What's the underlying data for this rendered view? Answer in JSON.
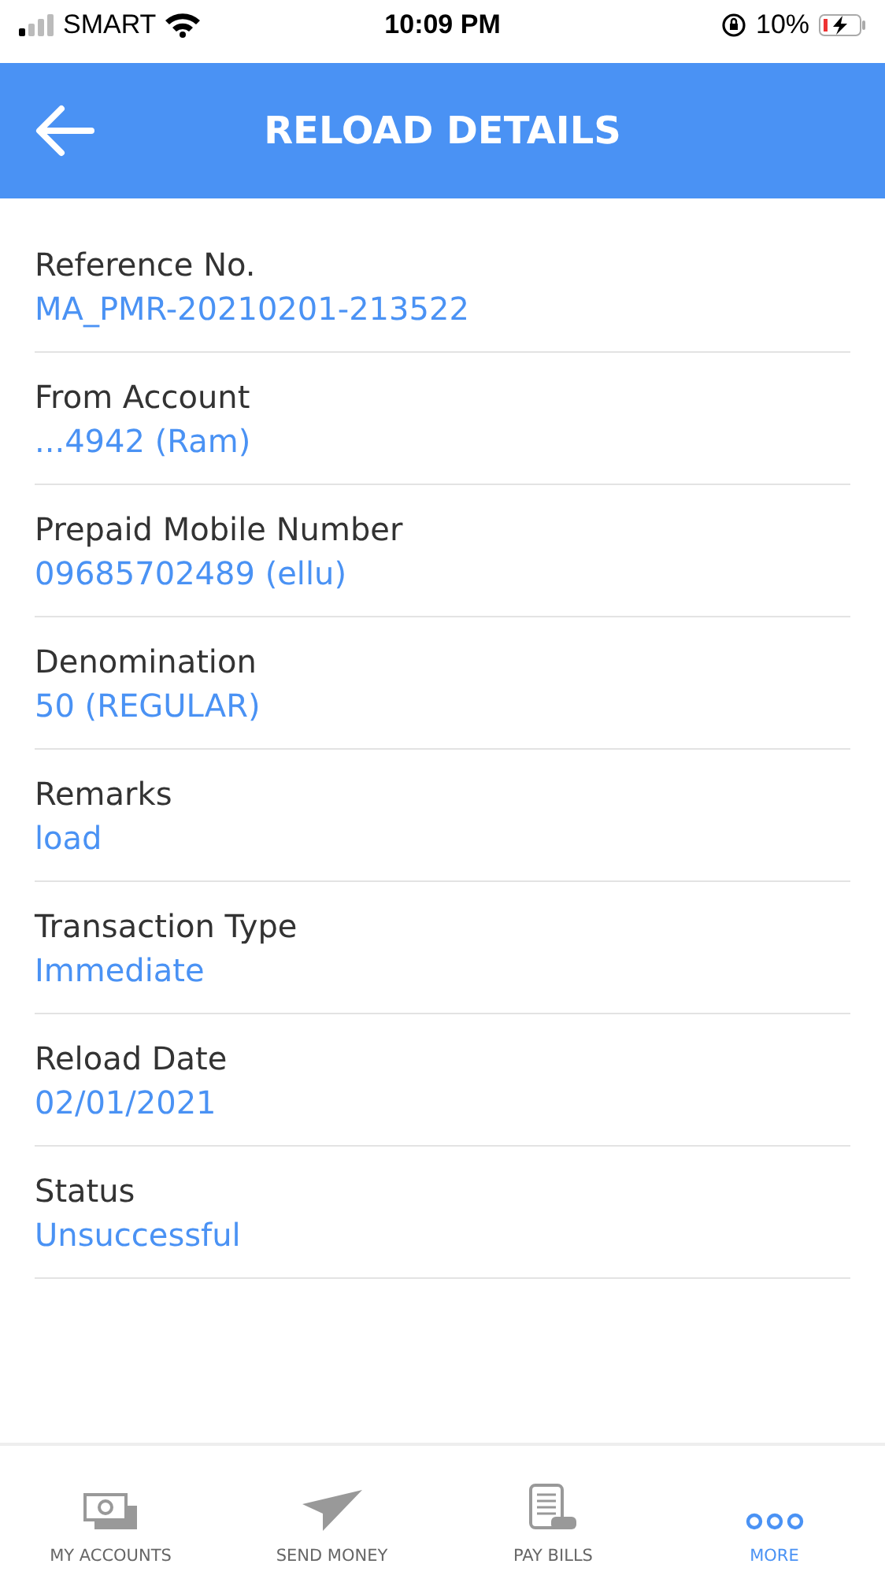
{
  "status_bar": {
    "carrier": "SMART",
    "time": "10:09 PM",
    "battery": "10%"
  },
  "header": {
    "title": "RELOAD DETAILS"
  },
  "details": [
    {
      "label": "Reference No.",
      "value": "MA_PMR-20210201-213522"
    },
    {
      "label": "From Account",
      "value": "...4942 (Ram)"
    },
    {
      "label": "Prepaid Mobile Number",
      "value": "09685702489 (ellu)"
    },
    {
      "label": "Denomination",
      "value": "50 (REGULAR)"
    },
    {
      "label": "Remarks",
      "value": "load"
    },
    {
      "label": "Transaction Type",
      "value": "Immediate"
    },
    {
      "label": "Reload Date",
      "value": "02/01/2021"
    },
    {
      "label": "Status",
      "value": "Unsuccessful"
    }
  ],
  "tabs": [
    {
      "label": "MY ACCOUNTS",
      "kind": "accounts",
      "selected": false
    },
    {
      "label": "SEND MONEY",
      "kind": "send",
      "selected": false
    },
    {
      "label": "PAY BILLS",
      "kind": "bills",
      "selected": false
    },
    {
      "label": "MORE",
      "kind": "more",
      "selected": true
    }
  ]
}
